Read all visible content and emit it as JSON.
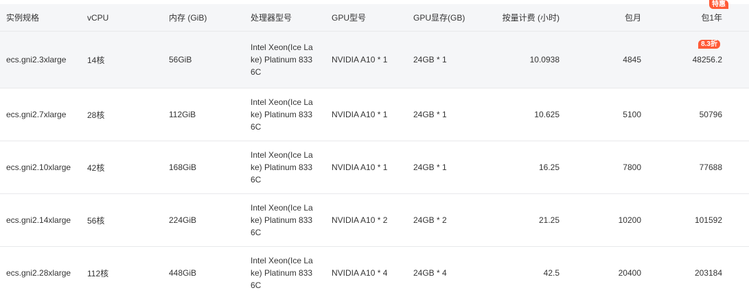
{
  "header": {
    "columns": [
      "实例规格",
      "vCPU",
      "内存 (GiB)",
      "处理器型号",
      "GPU型号",
      "GPU显存(GB)",
      "按量计费 (小时)",
      "包月",
      "包1年"
    ],
    "special_badge": "特惠"
  },
  "rows": [
    {
      "spec": "ecs.gni2.3xlarge",
      "vcpu": "14核",
      "mem": "56GiB",
      "cpu": "Intel Xeon(Ice Lake) Platinum 8336C",
      "gpu": "NVIDIA A10 * 1",
      "gpu_mem": "24GB * 1",
      "hourly": "10.0938",
      "monthly": "4845",
      "yearly": "48256.2",
      "discount": "8.3折"
    },
    {
      "spec": "ecs.gni2.7xlarge",
      "vcpu": "28核",
      "mem": "112GiB",
      "cpu": "Intel Xeon(Ice Lake) Platinum 8336C",
      "gpu": "NVIDIA A10 * 1",
      "gpu_mem": "24GB * 1",
      "hourly": "10.625",
      "monthly": "5100",
      "yearly": "50796"
    },
    {
      "spec": "ecs.gni2.10xlarge",
      "vcpu": "42核",
      "mem": "168GiB",
      "cpu": "Intel Xeon(Ice Lake) Platinum 8336C",
      "gpu": "NVIDIA A10 * 1",
      "gpu_mem": "24GB * 1",
      "hourly": "16.25",
      "monthly": "7800",
      "yearly": "77688"
    },
    {
      "spec": "ecs.gni2.14xlarge",
      "vcpu": "56核",
      "mem": "224GiB",
      "cpu": "Intel Xeon(Ice Lake) Platinum 8336C",
      "gpu": "NVIDIA A10 * 2",
      "gpu_mem": "24GB * 2",
      "hourly": "21.25",
      "monthly": "10200",
      "yearly": "101592"
    },
    {
      "spec": "ecs.gni2.28xlarge",
      "vcpu": "112核",
      "mem": "448GiB",
      "cpu": "Intel Xeon(Ice Lake) Platinum 8336C",
      "gpu": "NVIDIA A10 * 4",
      "gpu_mem": "24GB * 4",
      "hourly": "42.5",
      "monthly": "20400",
      "yearly": "203184"
    }
  ],
  "colors": {
    "header_bg": "#f5f6f8",
    "highlight_row_bg": "#f5f6f8",
    "border": "#e8e9eb",
    "badge": "#ff5a36",
    "text": "#333333"
  }
}
